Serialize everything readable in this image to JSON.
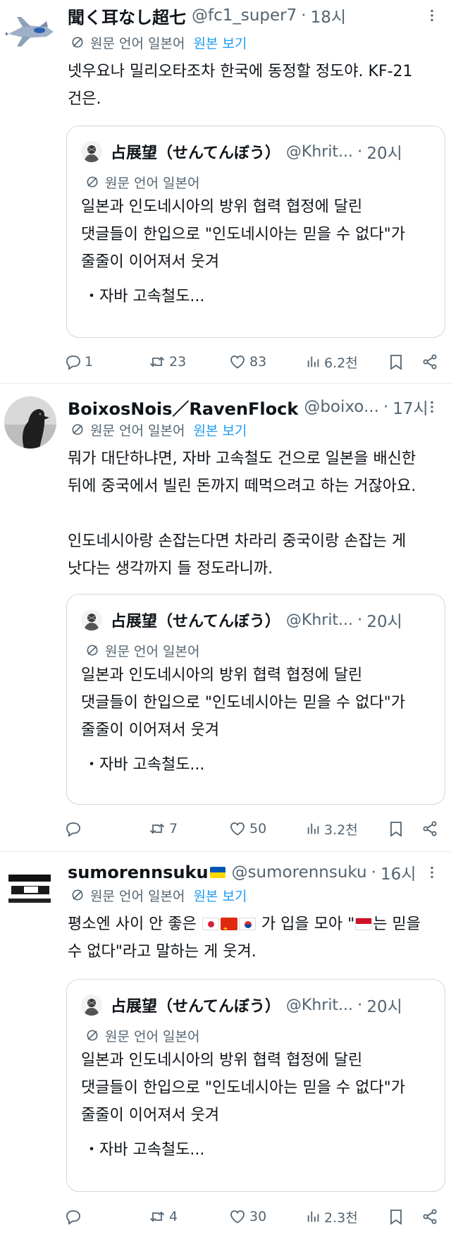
{
  "tweets": [
    {
      "name": "聞く耳なし超七",
      "handle": "@fc1_super7",
      "time": "18시",
      "translation": {
        "label": "원문 언어 일본어",
        "show": "원본 보기"
      },
      "body": [
        "넷우요나 밀리오타조차 한국에 동정할 정도야. KF-21",
        "건은."
      ],
      "quote": {
        "name": "占展望（せんてんぼう）",
        "handle": "@Khrit...",
        "time": "20시",
        "translation": "원문 언어 일본어",
        "body": [
          "일본과 인도네시아의 방위 협력 협정에 달린",
          "댓글들이 한입으로 \"인도네시아는 믿을 수 없다\"가",
          "줄줄이 이어져서 웃겨"
        ],
        "bullet": "・자바 고속철도..."
      },
      "stats": {
        "replies": "1",
        "reposts": "23",
        "likes": "83",
        "views": "6.2천"
      }
    },
    {
      "name": "BoixosNois／RavenFlock",
      "handle": "@boixo...",
      "time": "17시",
      "translation": {
        "label": "원문 언어 일본어",
        "show": "원본 보기"
      },
      "body": [
        "뭐가 대단하냐면, 자바 고속철도 건으로 일본을 배신한",
        "뒤에 중국에서 빌린 돈까지 떼먹으려고 하는 거잖아요.",
        "",
        "인도네시아랑 손잡는다면 차라리 중국이랑 손잡는 게",
        "낫다는 생각까지 들 정도라니까."
      ],
      "quote": {
        "name": "占展望（せんてんぼう）",
        "handle": "@Khrit...",
        "time": "20시",
        "translation": "원문 언어 일본어",
        "body": [
          "일본과 인도네시아의 방위 협력 협정에 달린",
          "댓글들이 한입으로 \"인도네시아는 믿을 수 없다\"가",
          "줄줄이 이어져서 웃겨"
        ],
        "bullet": "・자바 고속철도..."
      },
      "stats": {
        "replies": "",
        "reposts": "7",
        "likes": "50",
        "views": "3.2천"
      }
    },
    {
      "name": "sumorennsuku",
      "handle": "@sumorennsuku",
      "time": "16시",
      "translation": {
        "label": "원문 언어 일본어",
        "show": "원본 보기"
      },
      "body_parts": {
        "a": "평소엔 사이 안 좋은 ",
        "b": " 가 입을 모아 \"",
        "c": "는 믿을",
        "d": "수 없다\"라고 말하는 게 웃겨."
      },
      "quote": {
        "name": "占展望（せんてんぼう）",
        "handle": "@Khrit...",
        "time": "20시",
        "translation": "원문 언어 일본어",
        "body": [
          "일본과 인도네시아의 방위 협력 협정에 달린",
          "댓글들이 한입으로 \"인도네시아는 믿을 수 없다\"가",
          "줄줄이 이어져서 웃겨"
        ],
        "bullet": "・자바 고속철도..."
      },
      "stats": {
        "replies": "",
        "reposts": "4",
        "likes": "30",
        "views": "2.3천"
      }
    }
  ],
  "icons": {
    "translate": "translate-icon",
    "more": "more-icon",
    "reply": "reply-icon",
    "repost": "repost-icon",
    "like": "like-icon",
    "views": "views-icon",
    "bookmark": "bookmark-icon",
    "share": "share-icon"
  },
  "colors": {
    "link": "#1d9bf0",
    "muted": "#536471",
    "text": "#0f1419",
    "border": "#cfd9de"
  }
}
